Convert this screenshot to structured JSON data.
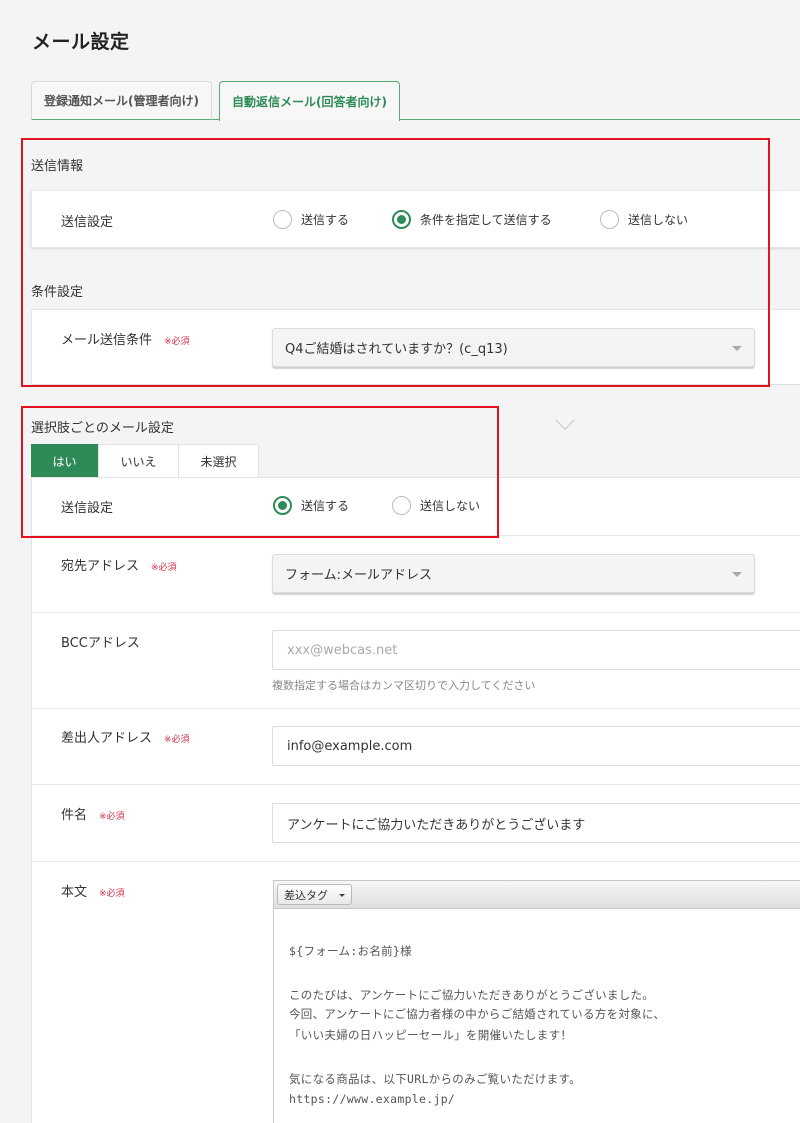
{
  "page": {
    "title": "メール設定"
  },
  "tabs": [
    {
      "label": "登録通知メール(管理者向け)",
      "active": false
    },
    {
      "label": "自動返信メール(回答者向け)",
      "active": true
    }
  ],
  "send_info": {
    "heading": "送信情報",
    "send_setting_label": "送信設定",
    "options": [
      "送信する",
      "条件を指定して送信する",
      "送信しない"
    ],
    "selected": "条件を指定して送信する"
  },
  "condition": {
    "heading": "条件設定",
    "label": "メール送信条件",
    "required": "※必須",
    "value": "Q4ご結婚はされていますか？(c_q13)"
  },
  "per_choice": {
    "heading": "選択肢ごとのメール設定",
    "choices": [
      "はい",
      "いいえ",
      "未選択"
    ],
    "active_choice": "はい",
    "send_setting_label": "送信設定",
    "options": [
      "送信する",
      "送信しない"
    ],
    "selected": "送信する"
  },
  "fields": {
    "to": {
      "label": "宛先アドレス",
      "required": "※必須",
      "value": "フォーム:メールアドレス"
    },
    "bcc": {
      "label": "BCCアドレス",
      "placeholder": "xxx@webcas.net",
      "hint": "複数指定する場合はカンマ区切りで入力してください"
    },
    "from": {
      "label": "差出人アドレス",
      "required": "※必須",
      "value": "info@example.com"
    },
    "subject": {
      "label": "件名",
      "required": "※必須",
      "value": "アンケートにご協力いただきありがとうございます"
    },
    "body": {
      "label": "本文",
      "required": "※必須",
      "insert_tag_label": "差込タグ",
      "lines": [
        "${フォーム:お名前}様",
        "",
        "このたびは、アンケートにご協力いただきありがとうございました。",
        "今回、アンケートにご協力者様の中からご結婚されている方を対象に、",
        "「いい夫婦の日ハッピーセール」を開催いたします！",
        "",
        "気になる商品は、以下URLからのみご覧いただけます。",
        "https://www.example.jp/"
      ]
    }
  },
  "colors": {
    "accent": "#2e8b57",
    "required": "#d6304a",
    "highlight": "#e0141e"
  }
}
